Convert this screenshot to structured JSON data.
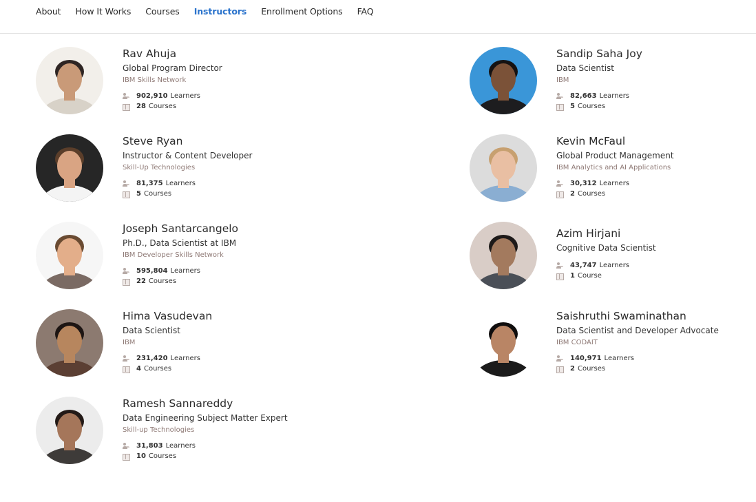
{
  "nav": {
    "items": [
      {
        "label": "About"
      },
      {
        "label": "How It Works"
      },
      {
        "label": "Courses"
      },
      {
        "label": "Instructors"
      },
      {
        "label": "Enrollment Options"
      },
      {
        "label": "FAQ"
      }
    ],
    "active": "Instructors"
  },
  "instructors": [
    {
      "name": "Rav Ahuja",
      "title": "Global Program Director",
      "org": "IBM Skills Network",
      "learners": "902,910",
      "learners_label": "Learners",
      "courses": "28",
      "courses_label": "Courses",
      "bg": "#f2efea",
      "skin": "#c99a78",
      "hair": "#2e2523",
      "shirt": "#d8d2c8"
    },
    {
      "name": "Sandip Saha Joy",
      "title": "Data Scientist",
      "org": "IBM",
      "learners": "82,663",
      "learners_label": "Learners",
      "courses": "5",
      "courses_label": "Courses",
      "bg": "#3a96d8",
      "skin": "#7b5238",
      "hair": "#151212",
      "shirt": "#1d1d1f"
    },
    {
      "name": "Steve Ryan",
      "title": "Instructor & Content Developer",
      "org": "Skill-Up Technologies",
      "learners": "81,375",
      "learners_label": "Learners",
      "courses": "5",
      "courses_label": "Courses",
      "bg": "#262626",
      "skin": "#d9a483",
      "hair": "#5b3e2a",
      "shirt": "#f4f4f4"
    },
    {
      "name": "Kevin McFaul",
      "title": "Global Product Management",
      "org": "IBM Analytics and AI Applications",
      "learners": "30,312",
      "learners_label": "Learners",
      "courses": "2",
      "courses_label": "Courses",
      "bg": "#dcdcdc",
      "skin": "#e9bfa3",
      "hair": "#c7a070",
      "shirt": "#8aaed2"
    },
    {
      "name": "Joseph Santarcangelo",
      "title": "Ph.D., Data Scientist at IBM",
      "org": "IBM Developer Skills Network",
      "learners": "595,804",
      "learners_label": "Learners",
      "courses": "22",
      "courses_label": "Courses",
      "bg": "#f6f6f6",
      "skin": "#e3ae8a",
      "hair": "#6a4b32",
      "shirt": "#7a6a63"
    },
    {
      "name": "Azim Hirjani",
      "title": "Cognitive Data Scientist",
      "org": "",
      "learners": "43,747",
      "learners_label": "Learners",
      "courses": "1",
      "courses_label": "Course",
      "bg": "#d9cdc7",
      "skin": "#a37a5e",
      "hair": "#1e1a19",
      "shirt": "#4a4f57"
    },
    {
      "name": "Hima Vasudevan",
      "title": "Data Scientist",
      "org": "IBM",
      "learners": "231,420",
      "learners_label": "Learners",
      "courses": "4",
      "courses_label": "Courses",
      "bg": "#8c7a70",
      "skin": "#b7865e",
      "hair": "#1d1513",
      "shirt": "#5b3f33"
    },
    {
      "name": "Saishruthi Swaminathan",
      "title": "Data Scientist and Developer Advocate",
      "org": "IBM CODAIT",
      "learners": "140,971",
      "learners_label": "Learners",
      "courses": "2",
      "courses_label": "Courses",
      "bg": "#ffffff",
      "skin": "#b98565",
      "hair": "#0f0d0d",
      "shirt": "#1b1b1b"
    },
    {
      "name": "Ramesh Sannareddy",
      "title": "Data Engineering Subject Matter Expert",
      "org": "Skill-up Technologies",
      "learners": "31,803",
      "learners_label": "Learners",
      "courses": "10",
      "courses_label": "Courses",
      "bg": "#ececec",
      "skin": "#a5765a",
      "hair": "#231a17",
      "shirt": "#3e3b39"
    }
  ]
}
